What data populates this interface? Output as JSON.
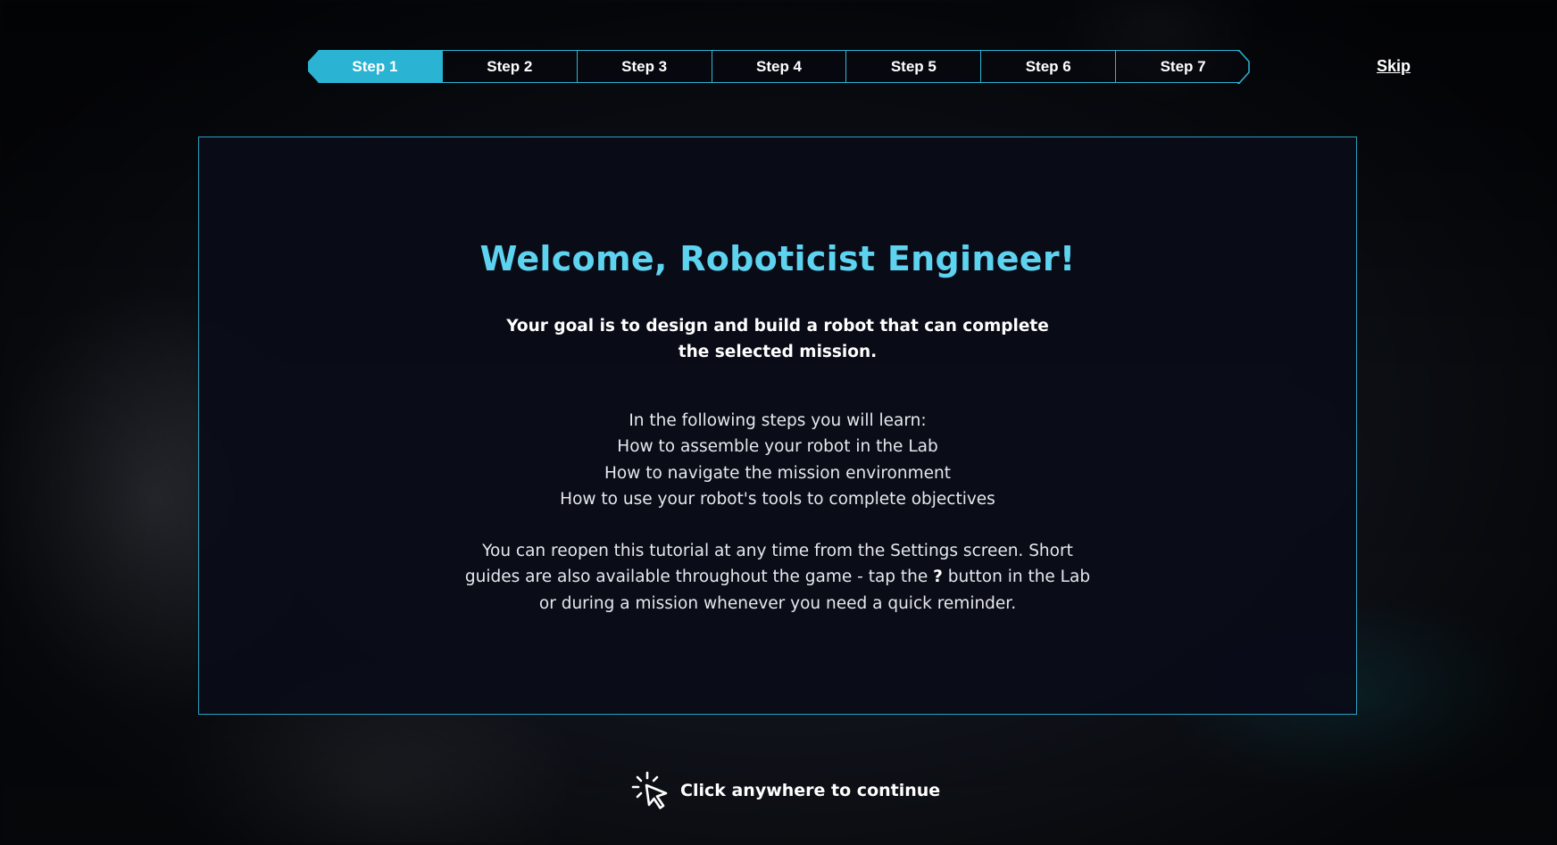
{
  "steps": [
    "Step 1",
    "Step 2",
    "Step 3",
    "Step 4",
    "Step 5",
    "Step 6",
    "Step 7"
  ],
  "active_step": 1,
  "skip_label": "Skip",
  "panel": {
    "title": "Welcome, Roboticist Engineer!",
    "goal_line1": "Your goal is to design and build a robot that can complete",
    "goal_line2": "the selected mission.",
    "learn_intro": "In the following steps you will learn:",
    "learn_items": [
      "How to assemble your robot in the Lab",
      "How to navigate the mission environment",
      "How to use your robot's tools to complete objectives"
    ],
    "note_part1": "You can reopen this tutorial at any time from the Settings screen. Short guides are also available throughout the game - tap the",
    "note_symbol": "?",
    "note_part2": "button in the Lab or during a mission whenever you need a quick reminder."
  },
  "continue_label": "Click anywhere to continue",
  "colors": {
    "accent": "#2bb3d4",
    "title": "#5dd3f0",
    "panel_border": "#2a9fc0"
  },
  "icons": {
    "continue": "click-pointer-icon"
  }
}
